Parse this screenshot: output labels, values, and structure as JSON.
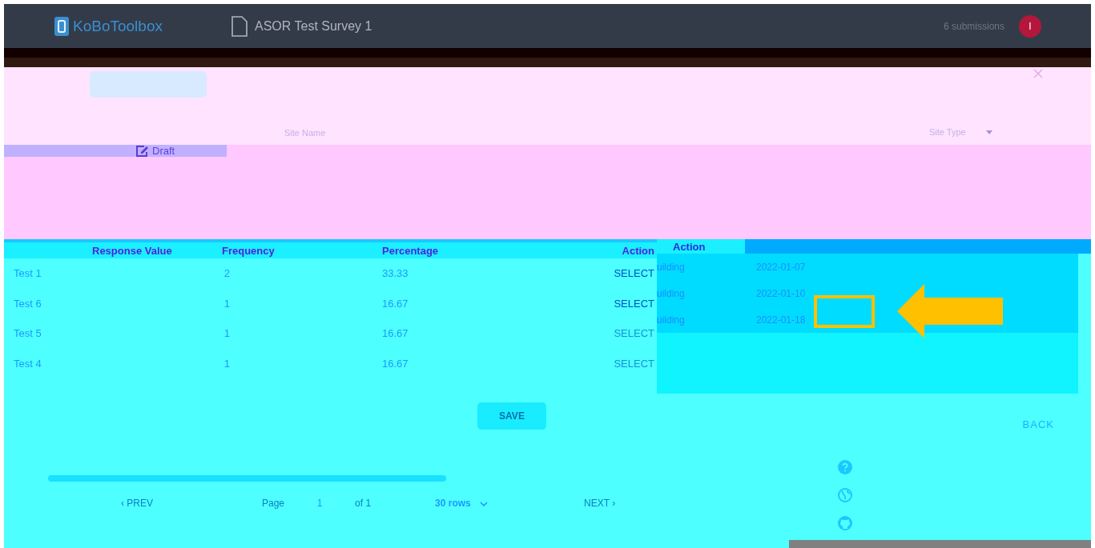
{
  "header": {
    "logo_text": "KoBoToolbox",
    "survey_title": "ASOR Test Survey 1",
    "submissions": "6 submissions",
    "avatar_letter": "I"
  },
  "filters": {
    "status_label": "Draft",
    "site_name_placeholder": "Site Name",
    "site_type_placeholder": "Site Type"
  },
  "modal_table": {
    "columns": [
      "Response Value",
      "Frequency",
      "Percentage",
      "Action"
    ],
    "rows": [
      {
        "response": "Test 1",
        "frequency": "2",
        "percentage": "33.33",
        "action": "SELECT",
        "disabled": false
      },
      {
        "response": "Test 6",
        "frequency": "1",
        "percentage": "16.67",
        "action": "SELECT",
        "disabled": false
      },
      {
        "response": "Test 5",
        "frequency": "1",
        "percentage": "16.67",
        "action": "SELECT",
        "disabled": true
      },
      {
        "response": "Test 4",
        "frequency": "1",
        "percentage": "16.67",
        "action": "SELECT",
        "disabled": true
      }
    ],
    "save": "SAVE"
  },
  "background_table": {
    "header": "Action",
    "rows": [
      {
        "type": "uilding",
        "date": "2022-01-07"
      },
      {
        "type": "uilding",
        "date": "2022-01-10"
      },
      {
        "type": "uilding",
        "date": "2022-01-18"
      }
    ]
  },
  "back": "BACK",
  "pagination": {
    "prev": "‹ PREV",
    "page_label": "Page",
    "page": "1",
    "of": "of 1",
    "rows": "30 rows",
    "next": "NEXT ›"
  }
}
